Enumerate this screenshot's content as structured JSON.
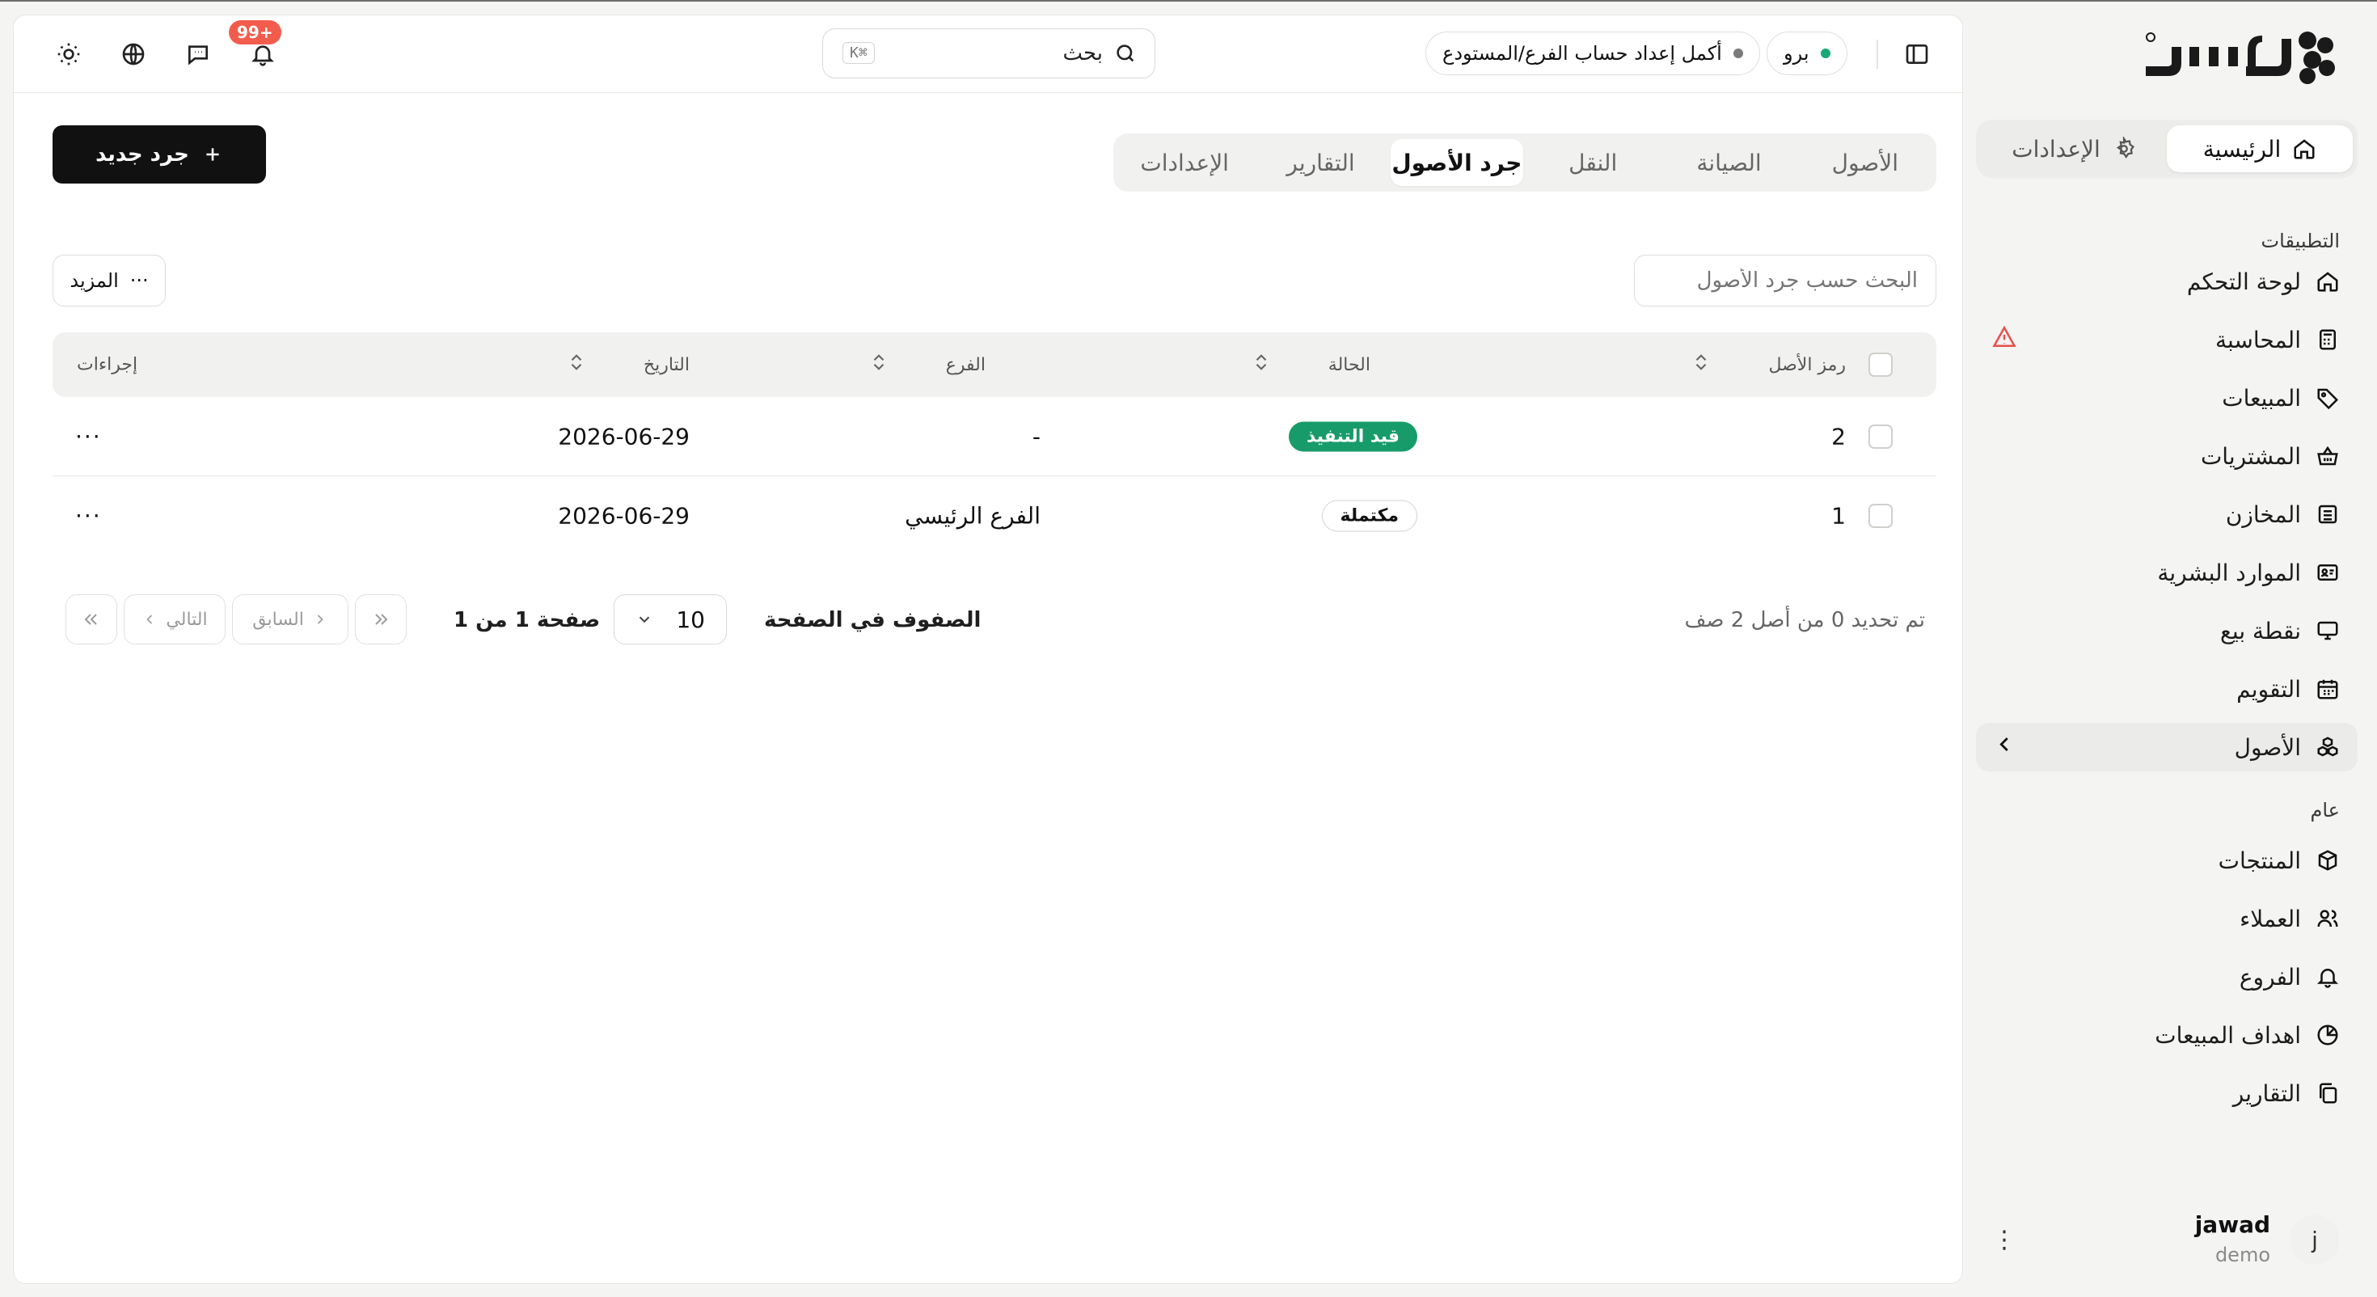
{
  "brand": {
    "logo_text": "سند"
  },
  "sidebar": {
    "segments": [
      {
        "label": "الرئيسية",
        "active": true
      },
      {
        "label": "الإعدادات",
        "active": false
      }
    ],
    "apps_title": "التطبيقات",
    "apps": [
      {
        "label": "لوحة التحكم"
      },
      {
        "label": "المحاسبة"
      },
      {
        "label": "المبيعات"
      },
      {
        "label": "المشتريات"
      },
      {
        "label": "المخازن"
      },
      {
        "label": "الموارد البشرية"
      },
      {
        "label": "نقطة بيع"
      },
      {
        "label": "التقويم"
      },
      {
        "label": "الأصول"
      }
    ],
    "general_title": "عام",
    "general": [
      {
        "label": "المنتجات"
      },
      {
        "label": "العملاء"
      },
      {
        "label": "الفروع"
      },
      {
        "label": "اهداف المبيعات"
      },
      {
        "label": "التقارير"
      }
    ],
    "user": {
      "initial": "j",
      "name": "jawad",
      "org": "demo"
    }
  },
  "header": {
    "notifications_badge": "+99",
    "search_label": "بحث",
    "search_shortcut": "⌘K",
    "setup_pill": "أكمل إعداد حساب الفرع/المستودع",
    "plan_pill": "برو"
  },
  "tabs": [
    {
      "label": "الأصول",
      "active": false
    },
    {
      "label": "الصيانة",
      "active": false
    },
    {
      "label": "النقل",
      "active": false
    },
    {
      "label": "جرد الأصول",
      "active": true
    },
    {
      "label": "التقارير",
      "active": false
    },
    {
      "label": "الإعدادات",
      "active": false
    }
  ],
  "actions": {
    "new_label": "جرد جديد",
    "more_label": "المزيد"
  },
  "filter": {
    "placeholder": "البحث حسب جرد الأصول"
  },
  "table": {
    "columns": {
      "code": "رمز الأصل",
      "status": "الحالة",
      "branch": "الفرع",
      "date": "التاريخ",
      "actions": "إجراءات"
    },
    "rows": [
      {
        "code": "2",
        "status": "قيد التنفيذ",
        "branch": "-",
        "date": "2026-06-29"
      },
      {
        "code": "1",
        "status": "مكتملة",
        "branch": "الفرع الرئيسي",
        "date": "2026-06-29"
      }
    ]
  },
  "pagination": {
    "selected_info": "تم تحديد 0 من أصل 2 صف",
    "rows_per_page_label": "الصفوف في الصفحة",
    "rows_per_page_value": "10",
    "page_info": "صفحة 1 من 1",
    "prev_label": "السابق",
    "next_label": "التالي"
  },
  "colors": {
    "accent_dark": "#111111",
    "status_green": "#189b6b",
    "badge_red": "#f25c4c",
    "warning_red": "#e8504a",
    "online_green": "#19a974"
  }
}
